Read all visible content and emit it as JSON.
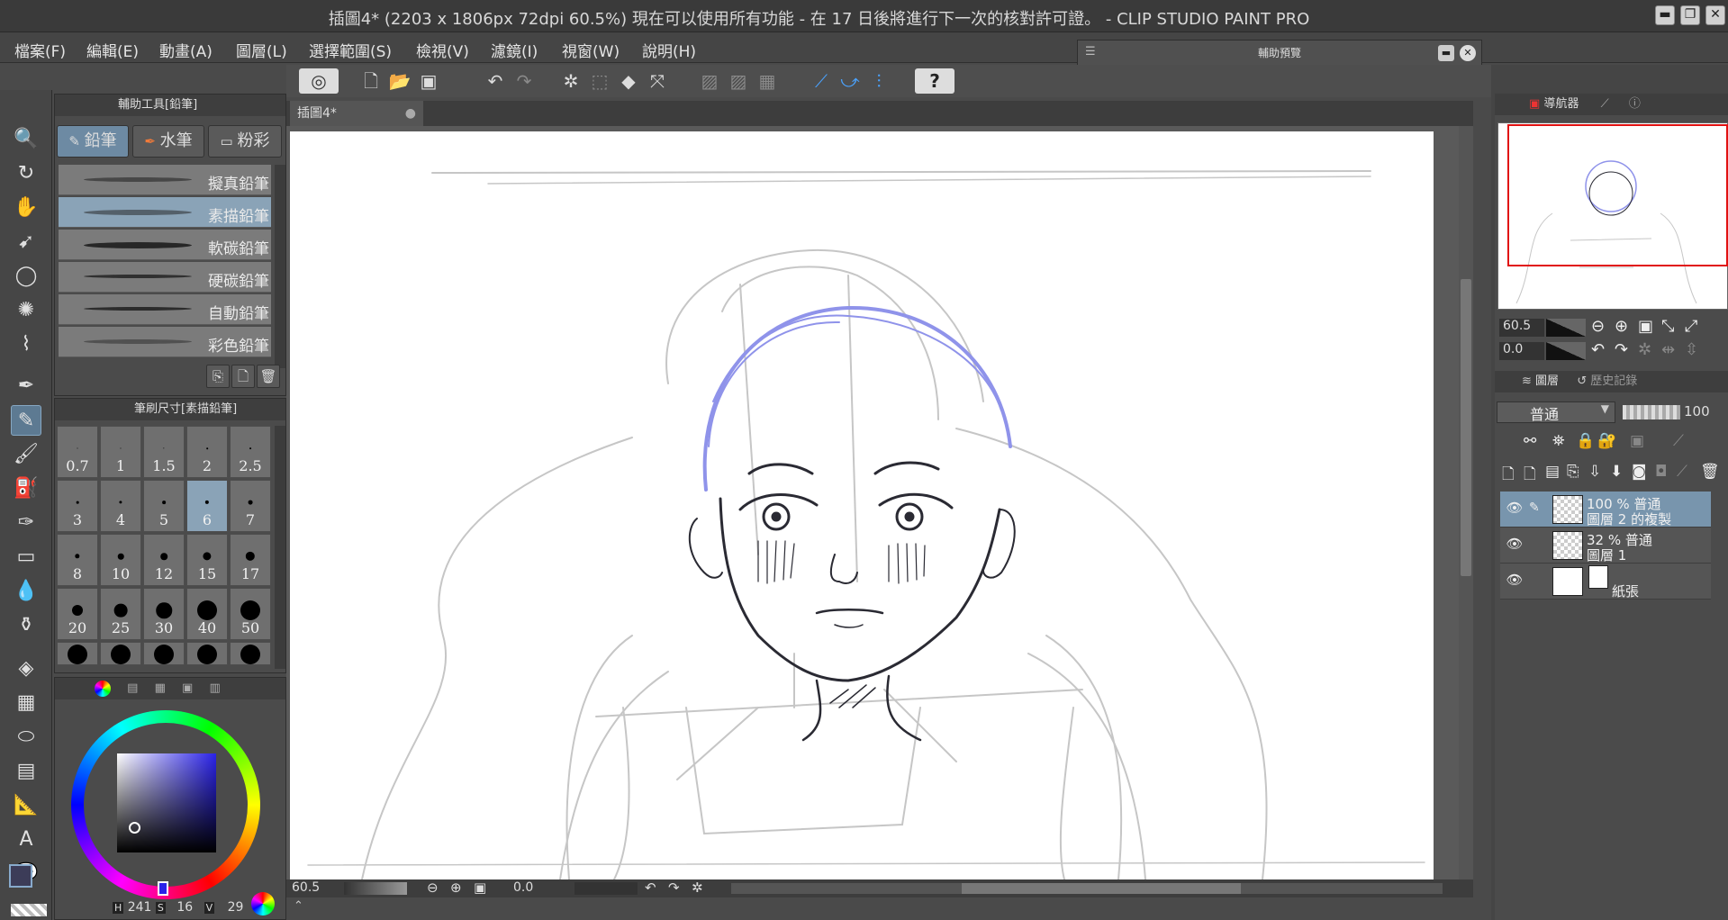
{
  "window": {
    "title": "插圖4* (2203 x 1806px 72dpi 60.5%)  現在可以使用所有功能 - 在 17 日後將進行下一次的核對許可證。 - CLIP STUDIO PAINT PRO",
    "minimize": "▬",
    "maximize": "❐",
    "close": "✕"
  },
  "menu": [
    "檔案(F)",
    "編輯(E)",
    "動畫(A)",
    "圖層(L)",
    "選擇範圍(S)",
    "檢視(V)",
    "濾鏡(I)",
    "視窗(W)",
    "說明(H)"
  ],
  "sub_view": {
    "title": "輔助預覽"
  },
  "sub_tool": {
    "title": "輔助工具[鉛筆]",
    "tabs": [
      "鉛筆",
      "水筆",
      "粉彩"
    ],
    "brushes": [
      "擬真鉛筆",
      "素描鉛筆",
      "軟碳鉛筆",
      "硬碳鉛筆",
      "自動鉛筆",
      "彩色鉛筆"
    ],
    "selected_index": 1
  },
  "brush_size": {
    "title": "筆刷尺寸[素描鉛筆]",
    "sizes": [
      "0.7",
      "1",
      "1.5",
      "2",
      "2.5",
      "3",
      "4",
      "5",
      "6",
      "7",
      "8",
      "10",
      "12",
      "15",
      "17",
      "20",
      "25",
      "30",
      "40",
      "50",
      "",
      "",
      "",
      "",
      ""
    ],
    "selected": "6"
  },
  "color": {
    "h_label": "H",
    "h": "241",
    "s_label": "S",
    "s": "16",
    "v_label": "V",
    "v": "29",
    "main_color": "#3c3c58",
    "sub_color": "#b9b399"
  },
  "document": {
    "tab": "插圖4*",
    "zoom": "60.5",
    "angle": "0.0"
  },
  "navigator": {
    "tab": "導航器",
    "zoom": "60.5",
    "angle": "0.0"
  },
  "layers": {
    "tab": "圖層",
    "history_tab": "歷史記錄",
    "blend_mode": "普通",
    "opacity": "100",
    "items": [
      {
        "line1": "100 % 普通",
        "line2": "圖層 2 的複製",
        "selected": true
      },
      {
        "line1": "32 % 普通",
        "line2": "圖層 1",
        "selected": false
      },
      {
        "line1": "",
        "line2": "紙張",
        "selected": false
      }
    ]
  },
  "colors": {
    "sketch_blue": "#8f93ea",
    "pencil_dark": "#2a2a33",
    "pencil_light": "#c6c6c6",
    "nav_frame": "#e11111"
  }
}
